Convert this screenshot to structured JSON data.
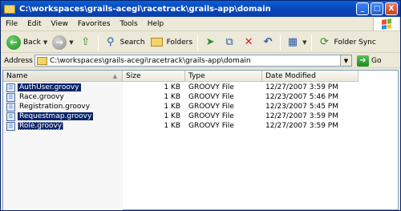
{
  "window": {
    "title": "C:\\workspaces\\grails-acegi\\racetrack\\grails-app\\domain",
    "min_label": "_",
    "max_label": "□",
    "close_label": "X"
  },
  "menu": [
    "File",
    "Edit",
    "View",
    "Favorites",
    "Tools",
    "Help"
  ],
  "toolbar": {
    "back_label": "Back",
    "search_label": "Search",
    "folders_label": "Folders",
    "folder_sync_label": "Folder Sync"
  },
  "address": {
    "label": "Address",
    "value": "C:\\workspaces\\grails-acegi\\racetrack\\grails-app\\domain",
    "go_label": "Go"
  },
  "columns": {
    "name": "Name",
    "size": "Size",
    "type": "Type",
    "date": "Date Modified"
  },
  "files": [
    {
      "name": "AuthUser.groovy",
      "size": "1 KB",
      "type": "GROOVY File",
      "date": "12/27/2007 3:59 PM",
      "selected": true
    },
    {
      "name": "Race.groovy",
      "size": "1 KB",
      "type": "GROOVY File",
      "date": "12/23/2007 5:46 PM",
      "selected": false
    },
    {
      "name": "Registration.groovy",
      "size": "1 KB",
      "type": "GROOVY File",
      "date": "12/23/2007 5:45 PM",
      "selected": false
    },
    {
      "name": "Requestmap.groovy",
      "size": "1 KB",
      "type": "GROOVY File",
      "date": "12/27/2007 3:59 PM",
      "selected": true
    },
    {
      "name": "Role.groovy",
      "size": "1 KB",
      "type": "GROOVY File",
      "date": "12/27/2007 3:59 PM",
      "selected": true
    }
  ],
  "colors": {
    "titlebar": "#0a5fd8",
    "selection": "#0a246a",
    "chrome": "#ece9d8"
  }
}
